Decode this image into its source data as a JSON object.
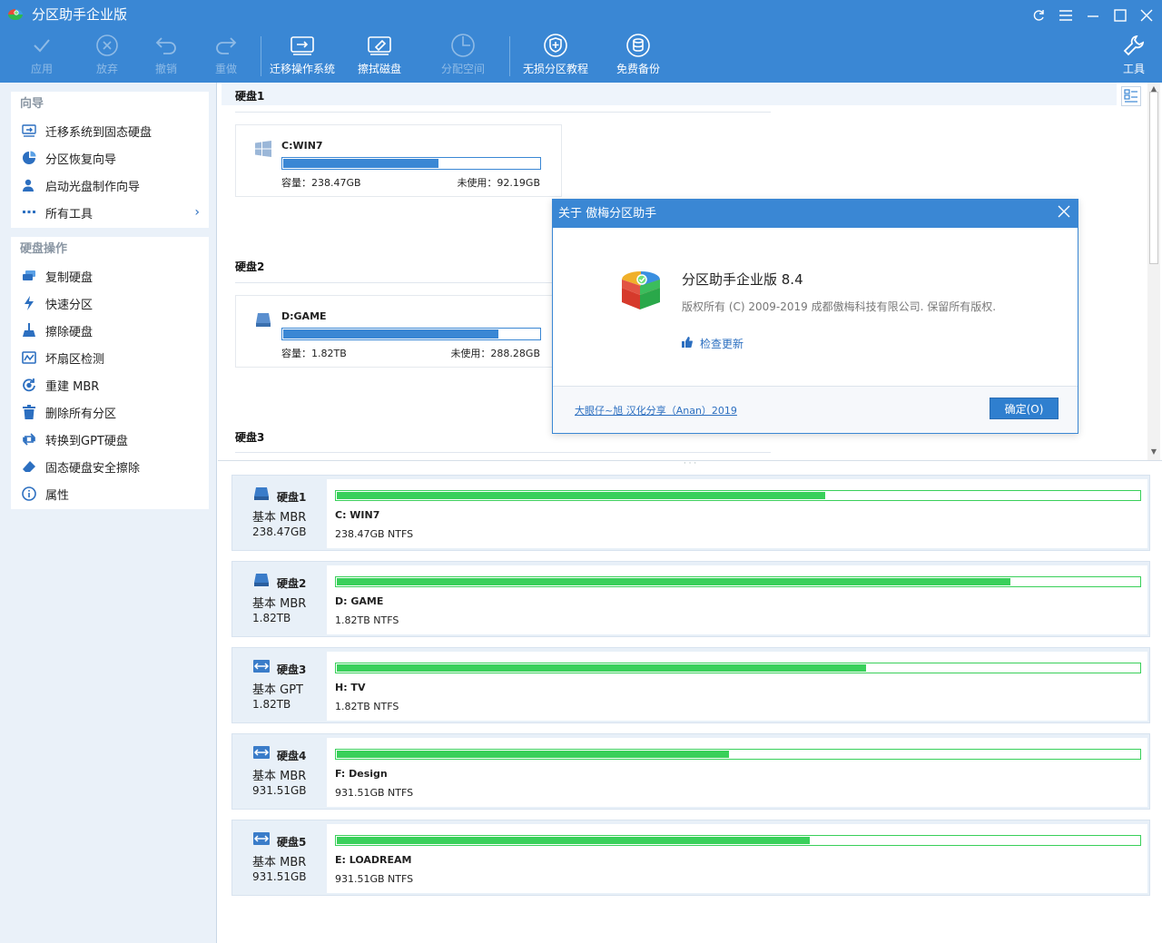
{
  "app": {
    "title": "分区助手企业版"
  },
  "toolbar": {
    "apply": "应用",
    "discard": "放弃",
    "undo": "撤销",
    "redo": "重做",
    "migrate": "迁移操作系统",
    "wipe": "擦拭磁盘",
    "allocate": "分配空间",
    "tutorial": "无损分区教程",
    "backup": "免费备份",
    "tools": "工具"
  },
  "sidebar": {
    "wizard_title": "向导",
    "wizard_items": [
      {
        "label": "迁移系统到固态硬盘",
        "icon": "migrate-icon"
      },
      {
        "label": "分区恢复向导",
        "icon": "pie-chart-icon"
      },
      {
        "label": "启动光盘制作向导",
        "icon": "user-icon"
      },
      {
        "label": "所有工具",
        "icon": "more-icon"
      }
    ],
    "disk_ops_title": "硬盘操作",
    "disk_ops_items": [
      {
        "label": "复制硬盘",
        "icon": "copy-disk-icon"
      },
      {
        "label": "快速分区",
        "icon": "lightning-icon"
      },
      {
        "label": "擦除硬盘",
        "icon": "broom-icon"
      },
      {
        "label": "坏扇区检测",
        "icon": "sector-check-icon"
      },
      {
        "label": "重建 MBR",
        "icon": "rebuild-icon"
      },
      {
        "label": "删除所有分区",
        "icon": "trash-icon"
      },
      {
        "label": "转换到GPT硬盘",
        "icon": "convert-icon"
      },
      {
        "label": "固态硬盘安全擦除",
        "icon": "eraser-icon"
      },
      {
        "label": "属性",
        "icon": "info-icon"
      }
    ]
  },
  "map": {
    "disks": [
      {
        "title": "硬盘1",
        "partition": "C:WIN7",
        "capacity": "容量：238.47GB",
        "free": "未使用：92.19GB",
        "used_fraction": 0.61
      },
      {
        "title": "硬盘2",
        "partition": "D:GAME",
        "capacity": "容量：1.82TB",
        "free": "未使用：288.28GB",
        "used_fraction": 0.84
      },
      {
        "title": "硬盘3"
      }
    ]
  },
  "disklist": [
    {
      "name": "硬盘1",
      "type": "基本 MBR",
      "size": "238.47GB",
      "partition": "C: WIN7",
      "detail": "238.47GB NTFS",
      "used_fraction": 0.61
    },
    {
      "name": "硬盘2",
      "type": "基本 MBR",
      "size": "1.82TB",
      "partition": "D: GAME",
      "detail": "1.82TB NTFS",
      "used_fraction": 0.84
    },
    {
      "name": "硬盘3",
      "type": "基本 GPT",
      "size": "1.82TB",
      "partition": "H: TV",
      "detail": "1.82TB NTFS",
      "used_fraction": 0.66
    },
    {
      "name": "硬盘4",
      "type": "基本 MBR",
      "size": "931.51GB",
      "partition": "F: Design",
      "detail": "931.51GB NTFS",
      "used_fraction": 0.49
    },
    {
      "name": "硬盘5",
      "type": "基本 MBR",
      "size": "931.51GB",
      "partition": "E: LOADREAM",
      "detail": "931.51GB NTFS",
      "used_fraction": 0.59
    }
  ],
  "dialog": {
    "title": "关于 傲梅分区助手",
    "product": "分区助手企业版 8.4",
    "copyright": "版权所有 (C) 2009-2019 成都傲梅科技有限公司. 保留所有版权.",
    "update": "检查更新",
    "credit": "大眼仔~旭 汉化分享（Anan）2019",
    "ok": "确定(O)"
  },
  "colors": {
    "primary": "#3a87d4",
    "bar_green": "#39d05a",
    "sidebar_bg": "#eaf1f9"
  }
}
